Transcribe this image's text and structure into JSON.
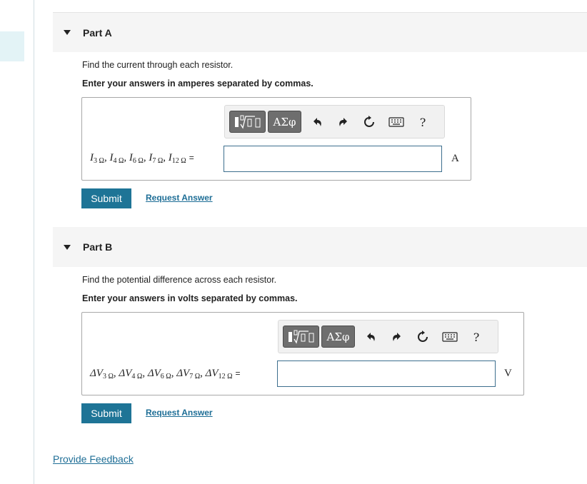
{
  "partA": {
    "title": "Part A",
    "question": "Find the current through each resistor.",
    "instruction": "Enter your answers in amperes separated by commas.",
    "toolbar": {
      "symbols_label": "ΑΣφ",
      "help_label": "?"
    },
    "formula": {
      "symbol": "I",
      "items": [
        {
          "sub": "3 Ω",
          "sep": ", "
        },
        {
          "sub": "4 Ω",
          "sep": ", "
        },
        {
          "sub": "6 Ω",
          "sep": ", "
        },
        {
          "sub": "7 Ω",
          "sep": ", "
        },
        {
          "sub": "12 Ω",
          "sep": ""
        }
      ],
      "equals": "="
    },
    "answer_value": "",
    "unit": "A",
    "submit_label": "Submit",
    "request_label": "Request Answer"
  },
  "partB": {
    "title": "Part B",
    "question": "Find the potential difference across each resistor.",
    "instruction": "Enter your answers in volts separated by commas.",
    "toolbar": {
      "symbols_label": "ΑΣφ",
      "help_label": "?"
    },
    "formula": {
      "symbol": "ΔV",
      "items": [
        {
          "sub": "3 Ω",
          "sep": ", "
        },
        {
          "sub": "4 Ω",
          "sep": ", "
        },
        {
          "sub": "6 Ω",
          "sep": ", "
        },
        {
          "sub": "7 Ω",
          "sep": ", "
        },
        {
          "sub": "12 Ω",
          "sep": ""
        }
      ],
      "equals": "="
    },
    "answer_value": "",
    "unit": "V",
    "submit_label": "Submit",
    "request_label": "Request Answer"
  },
  "feedback_label": "Provide Feedback"
}
